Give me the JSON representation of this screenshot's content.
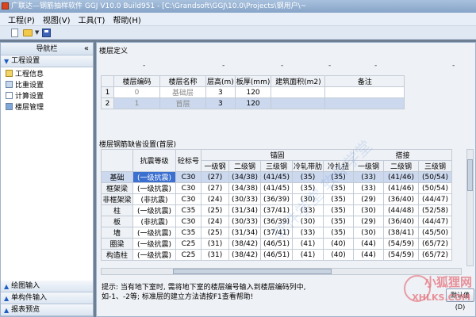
{
  "window": {
    "title": "广联达—钢筋抽样软件 GGJ V10.0 Build951 - [C:\\Grandsoft\\GGJ\\10.0\\Projects\\钢用户\\~"
  },
  "menu": {
    "items": [
      "工程(P)",
      "视图(V)",
      "工具(T)",
      "帮助(H)"
    ]
  },
  "sidebar": {
    "header": "导航栏",
    "collapse_glyph": "«",
    "section": "工程设置",
    "items": [
      "工程信息",
      "比重设置",
      "计算设置",
      "楼层管理"
    ],
    "bottom_sections": [
      "绘图输入",
      "单构件输入",
      "报表预览"
    ]
  },
  "main": {
    "floor_section_label": "楼层定义",
    "floor_table": {
      "headers": [
        "",
        "楼层编码",
        "楼层名称",
        "层高(m)",
        "板厚(mm)",
        "建筑面积(m2)",
        "备注"
      ],
      "rows": [
        [
          "1",
          "0",
          "基础层",
          "3",
          "120",
          "",
          ""
        ],
        [
          "2",
          "1",
          "首层",
          "3",
          "120",
          "",
          ""
        ]
      ]
    },
    "rebar_section_label": "楼层钢筋缺省设置(首层)",
    "rebar_table": {
      "group_headers": {
        "anchor": "锚固",
        "lap": "搭接"
      },
      "headers": [
        "",
        "抗震等级",
        "砼标号",
        "一级钢",
        "二级钢",
        "三级钢",
        "冷轧带肋",
        "冷扎扭",
        "一级钢",
        "二级钢",
        "三级钢"
      ],
      "rows": [
        [
          "基础",
          "(一级抗震)",
          "C30",
          "(27)",
          "(34/38)",
          "(41/45)",
          "(35)",
          "(35)",
          "(33)",
          "(41/46)",
          "(50/54)"
        ],
        [
          "框架梁",
          "(一级抗震)",
          "C30",
          "(27)",
          "(34/38)",
          "(41/45)",
          "(35)",
          "(35)",
          "(33)",
          "(41/46)",
          "(50/54)"
        ],
        [
          "非框架梁",
          "(非抗震)",
          "C30",
          "(24)",
          "(30/33)",
          "(36/39)",
          "(30)",
          "(35)",
          "(29)",
          "(36/40)",
          "(44/47)"
        ],
        [
          "柱",
          "(一级抗震)",
          "C35",
          "(25)",
          "(31/34)",
          "(37/41)",
          "(33)",
          "(35)",
          "(30)",
          "(44/48)",
          "(52/58)"
        ],
        [
          "板",
          "(非抗震)",
          "C30",
          "(24)",
          "(30/33)",
          "(36/39)",
          "(30)",
          "(35)",
          "(29)",
          "(36/40)",
          "(44/47)"
        ],
        [
          "墙",
          "(一级抗震)",
          "C35",
          "(25)",
          "(31/34)",
          "(37/41)",
          "(33)",
          "(35)",
          "(30)",
          "(38/41)",
          "(45/50)"
        ],
        [
          "圈梁",
          "(一级抗震)",
          "C25",
          "(31)",
          "(38/42)",
          "(46/51)",
          "(41)",
          "(40)",
          "(44)",
          "(54/59)",
          "(65/72)"
        ],
        [
          "构造柱",
          "(一级抗震)",
          "C25",
          "(31)",
          "(38/42)",
          "(46/51)",
          "(41)",
          "(40)",
          "(44)",
          "(54/59)",
          "(65/72)"
        ]
      ]
    },
    "hint_lines": [
      "提示: 当有地下室时, 需将地下室的楼层编号输入到楼层编码列中,",
      "如-1、-2等; 标准层的建立方法请按F1查看帮助!"
    ],
    "default_button": "默认值(D)"
  },
  "watermarks": {
    "diagonal": "软件学堂 软件学堂",
    "corner_cn": "小狐狸网",
    "corner_en": "XHLKS.COM"
  },
  "colors": {
    "selection": "#cbd8ee",
    "active_cell": "#3b6fd0"
  }
}
